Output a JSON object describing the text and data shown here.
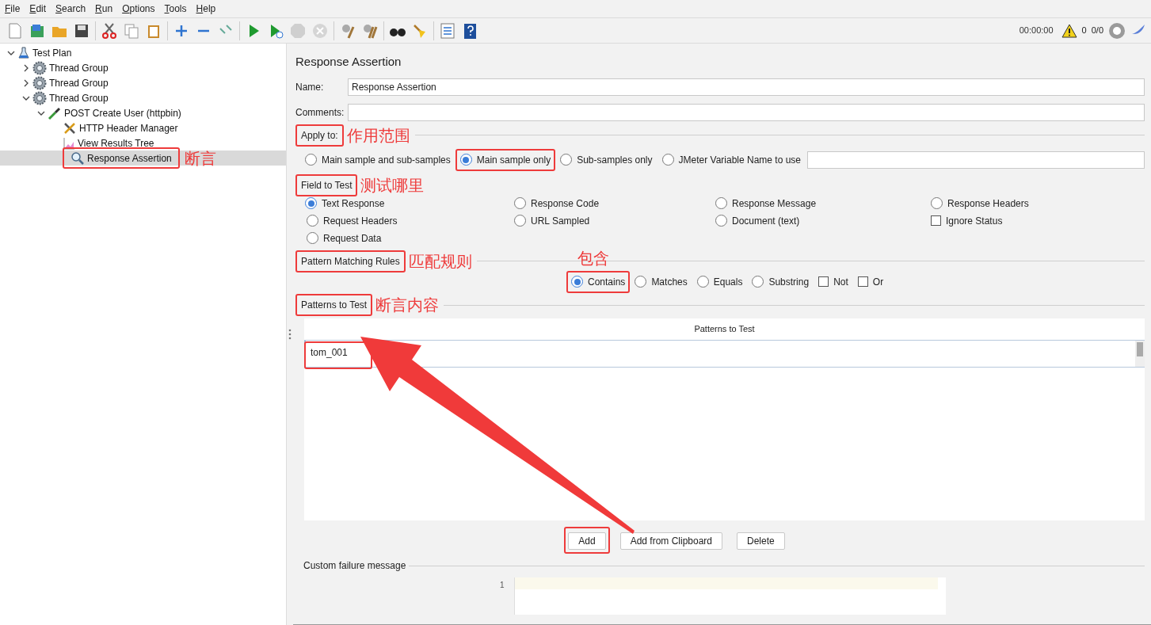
{
  "menu": [
    {
      "label": "File"
    },
    {
      "label": "Edit"
    },
    {
      "label": "Search"
    },
    {
      "label": "Run"
    },
    {
      "label": "Options"
    },
    {
      "label": "Tools"
    },
    {
      "label": "Help"
    }
  ],
  "status": {
    "time": "00:00:00",
    "warnings": "0",
    "threads": "0/0"
  },
  "tree": [
    {
      "label": "Test Plan",
      "kind": "plan",
      "expanded": true,
      "selected": false,
      "highlighted": false,
      "children": [
        {
          "label": "Thread Group",
          "kind": "thread_group",
          "expanded": false,
          "selected": false,
          "highlighted": false
        },
        {
          "label": "Thread Group",
          "kind": "thread_group",
          "expanded": false,
          "selected": false,
          "highlighted": false
        },
        {
          "label": "Thread Group",
          "kind": "thread_group",
          "expanded": true,
          "selected": false,
          "highlighted": false,
          "children": [
            {
              "label": "POST Create User (httpbin)",
              "kind": "sampler",
              "expanded": true,
              "selected": false,
              "highlighted": false,
              "children": [
                {
                  "label": "HTTP Header Manager",
                  "kind": "config",
                  "selected": false,
                  "highlighted": false
                },
                {
                  "label": "View Results Tree",
                  "kind": "listener",
                  "selected": false,
                  "highlighted": false
                },
                {
                  "label": "Response Assertion",
                  "kind": "assertion",
                  "selected": true,
                  "highlighted": true,
                  "note": "断言"
                }
              ]
            }
          ]
        }
      ]
    }
  ],
  "panel": {
    "title": "Response Assertion",
    "name": {
      "label": "Name:",
      "value": "Response Assertion"
    },
    "comments": {
      "label": "Comments:"
    },
    "apply_to": {
      "legend": "Apply to:",
      "highlighted": true,
      "note": "作用范围",
      "options": [
        {
          "label": "Main sample and sub-samples",
          "selected": false,
          "highlighted": false
        },
        {
          "label": "Main sample only",
          "selected": true,
          "highlighted": true
        },
        {
          "label": "Sub-samples only",
          "selected": false,
          "highlighted": false
        },
        {
          "label": "JMeter Variable Name to use",
          "selected": false,
          "highlighted": false
        }
      ]
    },
    "field_to_test": {
      "legend": "Field to Test",
      "highlighted": true,
      "note": "测试哪里",
      "options": [
        {
          "kind": "radio",
          "label": "Text Response",
          "selected": true
        },
        {
          "kind": "radio",
          "label": "Response Code",
          "selected": false
        },
        {
          "kind": "radio",
          "label": "Response Message",
          "selected": false
        },
        {
          "kind": "radio",
          "label": "Response Headers",
          "selected": false
        },
        {
          "kind": "radio",
          "label": "Request Headers",
          "selected": false
        },
        {
          "kind": "radio",
          "label": "URL Sampled",
          "selected": false
        },
        {
          "kind": "radio",
          "label": "Document (text)",
          "selected": false
        },
        {
          "kind": "checkbox",
          "label": "Ignore Status",
          "checked": false
        },
        {
          "kind": "radio",
          "label": "Request Data",
          "selected": false
        }
      ]
    },
    "pattern_rules": {
      "legend": "Pattern Matching Rules",
      "highlighted": true,
      "note": "匹配规则",
      "options": [
        {
          "kind": "radio",
          "label": "Contains",
          "selected": true,
          "highlighted": true,
          "note": "包含"
        },
        {
          "kind": "radio",
          "label": "Matches",
          "selected": false,
          "highlighted": false
        },
        {
          "kind": "radio",
          "label": "Equals",
          "selected": false,
          "highlighted": false
        },
        {
          "kind": "radio",
          "label": "Substring",
          "selected": false,
          "highlighted": false
        },
        {
          "kind": "checkbox",
          "label": "Not",
          "checked": false,
          "highlighted": false
        },
        {
          "kind": "checkbox",
          "label": "Or",
          "checked": false,
          "highlighted": false
        }
      ]
    },
    "patterns": {
      "legend": "Patterns to Test",
      "highlighted": true,
      "note": "断言内容",
      "column": "Patterns to Test",
      "rows": [
        {
          "value": "tom_001",
          "highlighted": true
        }
      ]
    },
    "buttons": [
      {
        "label": "Add",
        "highlighted": true
      },
      {
        "label": "Add from Clipboard",
        "highlighted": false
      },
      {
        "label": "Delete",
        "highlighted": false
      }
    ],
    "failure": {
      "legend": "Custom failure message",
      "line": "1"
    }
  }
}
